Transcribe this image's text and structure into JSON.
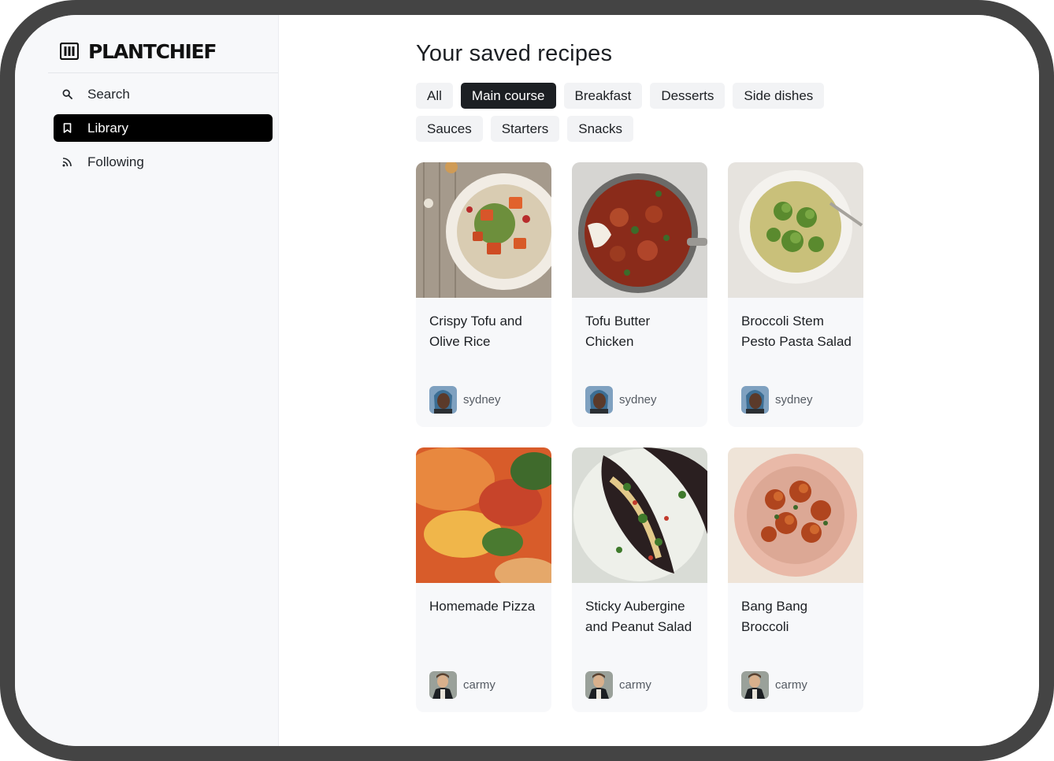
{
  "brand": {
    "name": "PLANTCHIEF",
    "icon": "utensils-logo-icon"
  },
  "nav": {
    "items": [
      {
        "label": "Search",
        "icon": "search-icon",
        "active": false
      },
      {
        "label": "Library",
        "icon": "bookmark-icon",
        "active": true
      },
      {
        "label": "Following",
        "icon": "rss-icon",
        "active": false
      }
    ]
  },
  "main": {
    "title": "Your saved recipes",
    "filters": [
      {
        "label": "All",
        "active": false
      },
      {
        "label": "Main course",
        "active": true
      },
      {
        "label": "Breakfast",
        "active": false
      },
      {
        "label": "Desserts",
        "active": false
      },
      {
        "label": "Side dishes",
        "active": false
      },
      {
        "label": "Sauces",
        "active": false
      },
      {
        "label": "Starters",
        "active": false
      },
      {
        "label": "Snacks",
        "active": false
      }
    ],
    "recipes": [
      {
        "title": "Crispy Tofu and Olive Rice",
        "author": "sydney"
      },
      {
        "title": "Tofu Butter Chicken",
        "author": "sydney"
      },
      {
        "title": "Broccoli Stem Pesto Pasta Salad",
        "author": "sydney"
      },
      {
        "title": "Homemade Pizza",
        "author": "carmy"
      },
      {
        "title": "Sticky Aubergine and Peanut Salad",
        "author": "carmy"
      },
      {
        "title": "Bang Bang Broccoli",
        "author": "carmy"
      }
    ]
  },
  "colors": {
    "accent": "#000000",
    "chip_bg": "#f2f3f5",
    "chip_active_bg": "#1c1f23",
    "card_bg": "#f7f8fa",
    "frame": "#444444"
  }
}
